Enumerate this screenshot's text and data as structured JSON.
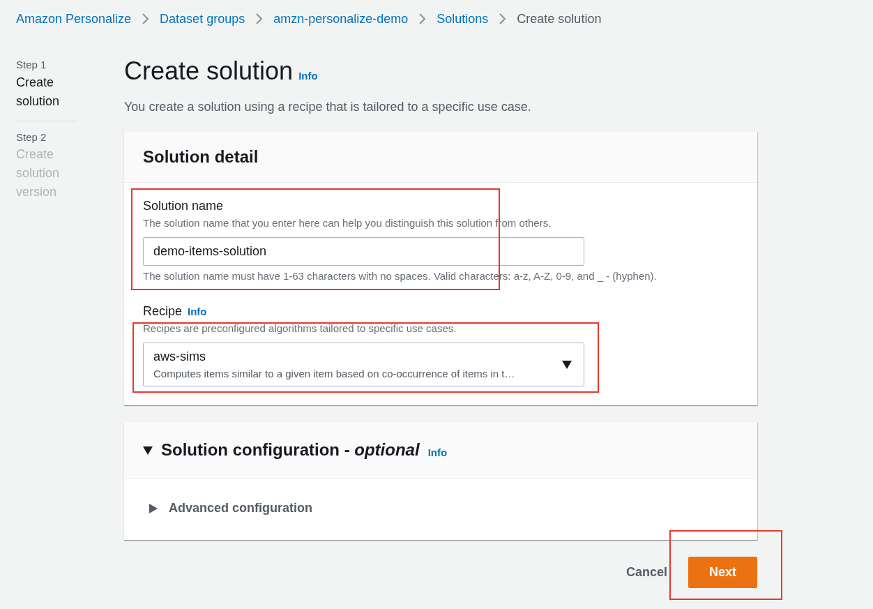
{
  "breadcrumbs": [
    {
      "label": "Amazon Personalize",
      "current": false
    },
    {
      "label": "Dataset groups",
      "current": false
    },
    {
      "label": "amzn-personalize-demo",
      "current": false
    },
    {
      "label": "Solutions",
      "current": false
    },
    {
      "label": "Create solution",
      "current": true
    }
  ],
  "steps": [
    {
      "step": "Step 1",
      "title": "Create solution",
      "selected": true
    },
    {
      "step": "Step 2",
      "title": "Create solution version",
      "selected": false
    }
  ],
  "page": {
    "title": "Create solution",
    "info": "Info",
    "description": "You create a solution using a recipe that is tailored to a specific use case."
  },
  "solution_detail": {
    "title": "Solution detail",
    "name_field": {
      "label": "Solution name",
      "description": "The solution name that you enter here can help you distinguish this solution from others.",
      "value": "demo-items-solution",
      "constraint": "The solution name must have 1-63 characters with no spaces. Valid characters: a-z, A-Z, 0-9, and _ - (hyphen).",
      "highlighted": true
    },
    "recipe": {
      "label": "Recipe",
      "info": "Info",
      "description": "Recipes are preconfigured algorithms tailored to specific use cases.",
      "value": "aws-sims",
      "value_description": "Computes items similar to a given item based on co-occurrence of items in t…",
      "highlighted": true
    }
  },
  "configuration": {
    "title": "Solution configuration - *optional*",
    "info": "Info",
    "expanded": true,
    "sections": [
      {
        "label": "Advanced configuration",
        "expanded": false
      }
    ]
  },
  "actions": [
    {
      "label": "Cancel",
      "kind": "link",
      "highlighted": false
    },
    {
      "label": "Next",
      "kind": "primary",
      "highlighted": true
    }
  ]
}
